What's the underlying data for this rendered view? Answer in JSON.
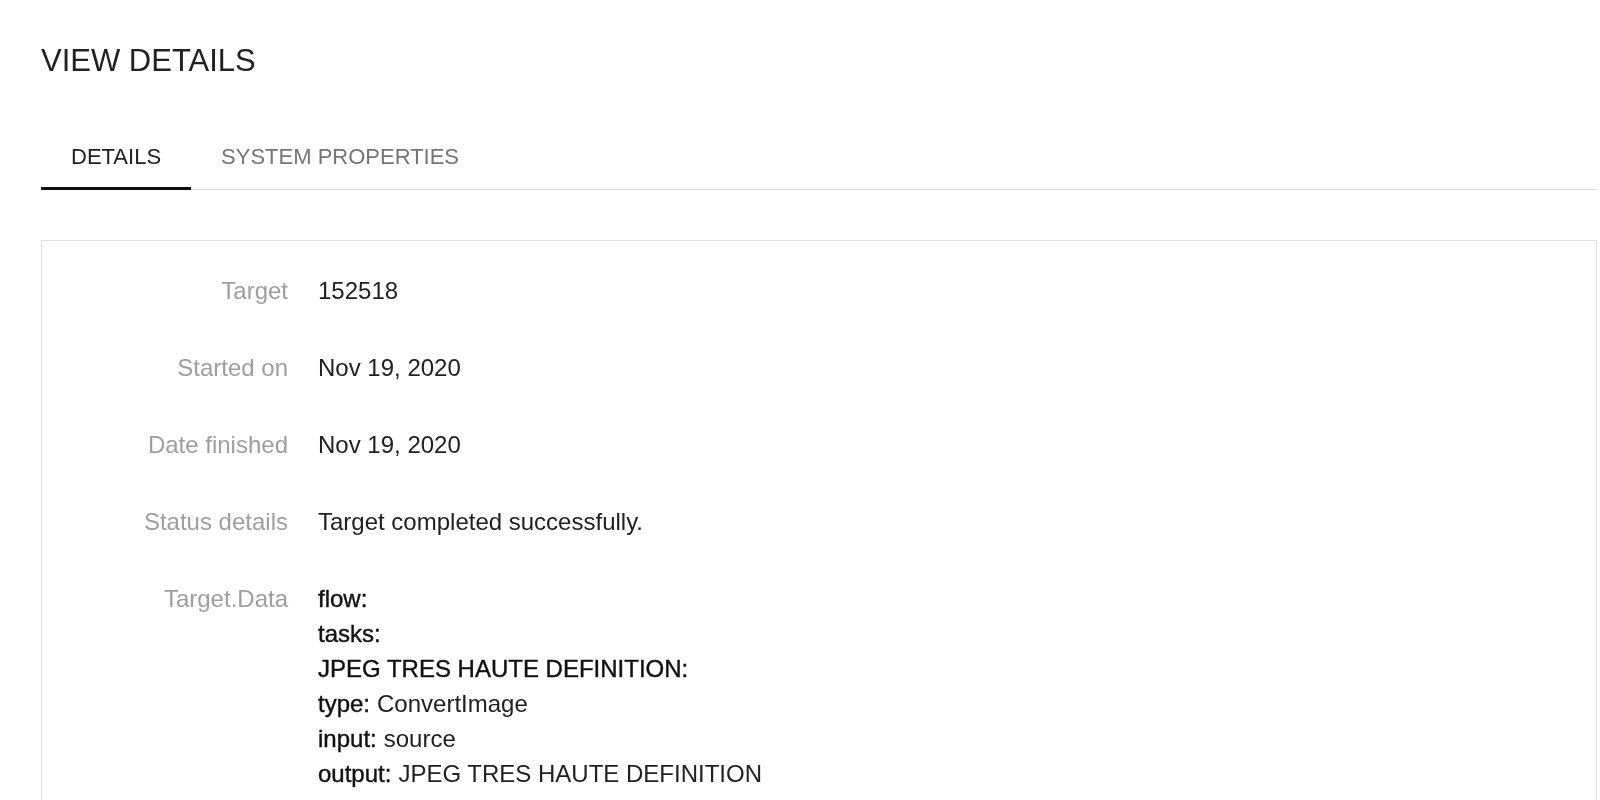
{
  "title": "VIEW DETAILS",
  "tabs": [
    {
      "label": "DETAILS",
      "selected": true
    },
    {
      "label": "SYSTEM PROPERTIES",
      "selected": false
    }
  ],
  "fields": [
    {
      "kind": "text",
      "label": "Target",
      "value": "152518"
    },
    {
      "kind": "text",
      "label": "Started on",
      "value": "Nov 19, 2020"
    },
    {
      "kind": "text",
      "label": "Date finished",
      "value": "Nov 19, 2020"
    },
    {
      "kind": "text",
      "label": "Status details",
      "value": "Target completed successfully."
    },
    {
      "kind": "data",
      "label": "Target.Data",
      "lines": [
        {
          "key": "flow:"
        },
        {
          "key": "tasks:"
        },
        {
          "key": "JPEG TRES HAUTE DEFINITION:"
        },
        {
          "key": "type:",
          "value": "ConvertImage"
        },
        {
          "key": "input:",
          "value": "source"
        },
        {
          "key": "output:",
          "value": "JPEG TRES HAUTE DEFINITION"
        }
      ]
    }
  ]
}
